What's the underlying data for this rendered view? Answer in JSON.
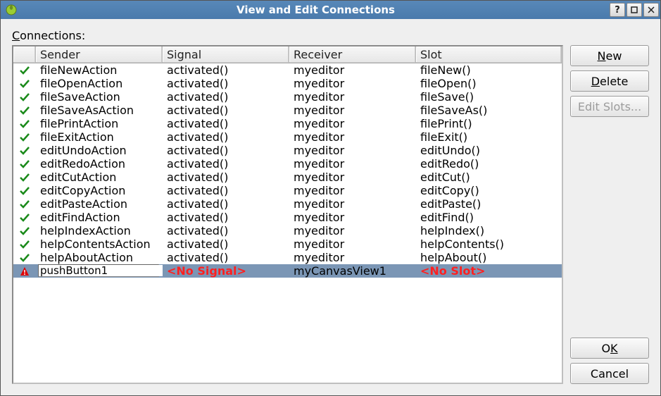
{
  "window": {
    "title": "View and Edit Connections",
    "help_btn": "?",
    "max_btn": "□",
    "close_btn": "×"
  },
  "label_prefix": "C",
  "label_rest": "onnections:",
  "headers": {
    "sender": "Sender",
    "signal": "Signal",
    "receiver": "Receiver",
    "slot": "Slot"
  },
  "rows": [
    {
      "valid": true,
      "sender": "fileNewAction",
      "signal": "activated()",
      "receiver": "myeditor",
      "slot": "fileNew()"
    },
    {
      "valid": true,
      "sender": "fileOpenAction",
      "signal": "activated()",
      "receiver": "myeditor",
      "slot": "fileOpen()"
    },
    {
      "valid": true,
      "sender": "fileSaveAction",
      "signal": "activated()",
      "receiver": "myeditor",
      "slot": "fileSave()"
    },
    {
      "valid": true,
      "sender": "fileSaveAsAction",
      "signal": "activated()",
      "receiver": "myeditor",
      "slot": "fileSaveAs()"
    },
    {
      "valid": true,
      "sender": "filePrintAction",
      "signal": "activated()",
      "receiver": "myeditor",
      "slot": "filePrint()"
    },
    {
      "valid": true,
      "sender": "fileExitAction",
      "signal": "activated()",
      "receiver": "myeditor",
      "slot": "fileExit()"
    },
    {
      "valid": true,
      "sender": "editUndoAction",
      "signal": "activated()",
      "receiver": "myeditor",
      "slot": "editUndo()"
    },
    {
      "valid": true,
      "sender": "editRedoAction",
      "signal": "activated()",
      "receiver": "myeditor",
      "slot": "editRedo()"
    },
    {
      "valid": true,
      "sender": "editCutAction",
      "signal": "activated()",
      "receiver": "myeditor",
      "slot": "editCut()"
    },
    {
      "valid": true,
      "sender": "editCopyAction",
      "signal": "activated()",
      "receiver": "myeditor",
      "slot": "editCopy()"
    },
    {
      "valid": true,
      "sender": "editPasteAction",
      "signal": "activated()",
      "receiver": "myeditor",
      "slot": "editPaste()"
    },
    {
      "valid": true,
      "sender": "editFindAction",
      "signal": "activated()",
      "receiver": "myeditor",
      "slot": "editFind()"
    },
    {
      "valid": true,
      "sender": "helpIndexAction",
      "signal": "activated()",
      "receiver": "myeditor",
      "slot": "helpIndex()"
    },
    {
      "valid": true,
      "sender": "helpContentsAction",
      "signal": "activated()",
      "receiver": "myeditor",
      "slot": "helpContents()"
    },
    {
      "valid": true,
      "sender": "helpAboutAction",
      "signal": "activated()",
      "receiver": "myeditor",
      "slot": "helpAbout()"
    },
    {
      "valid": false,
      "sender": "pushButton1",
      "signal": "<No Signal>",
      "receiver": "myCanvasView1",
      "slot": "<No Slot>",
      "selected": true,
      "editing": true
    }
  ],
  "buttons": {
    "new_u": "N",
    "new_rest": "ew",
    "delete_u": "D",
    "delete_rest": "elete",
    "editslots": "Edit Slots...",
    "editslots_disabled": true,
    "ok_pre": "O",
    "ok_u": "K",
    "cancel": "Cancel"
  }
}
